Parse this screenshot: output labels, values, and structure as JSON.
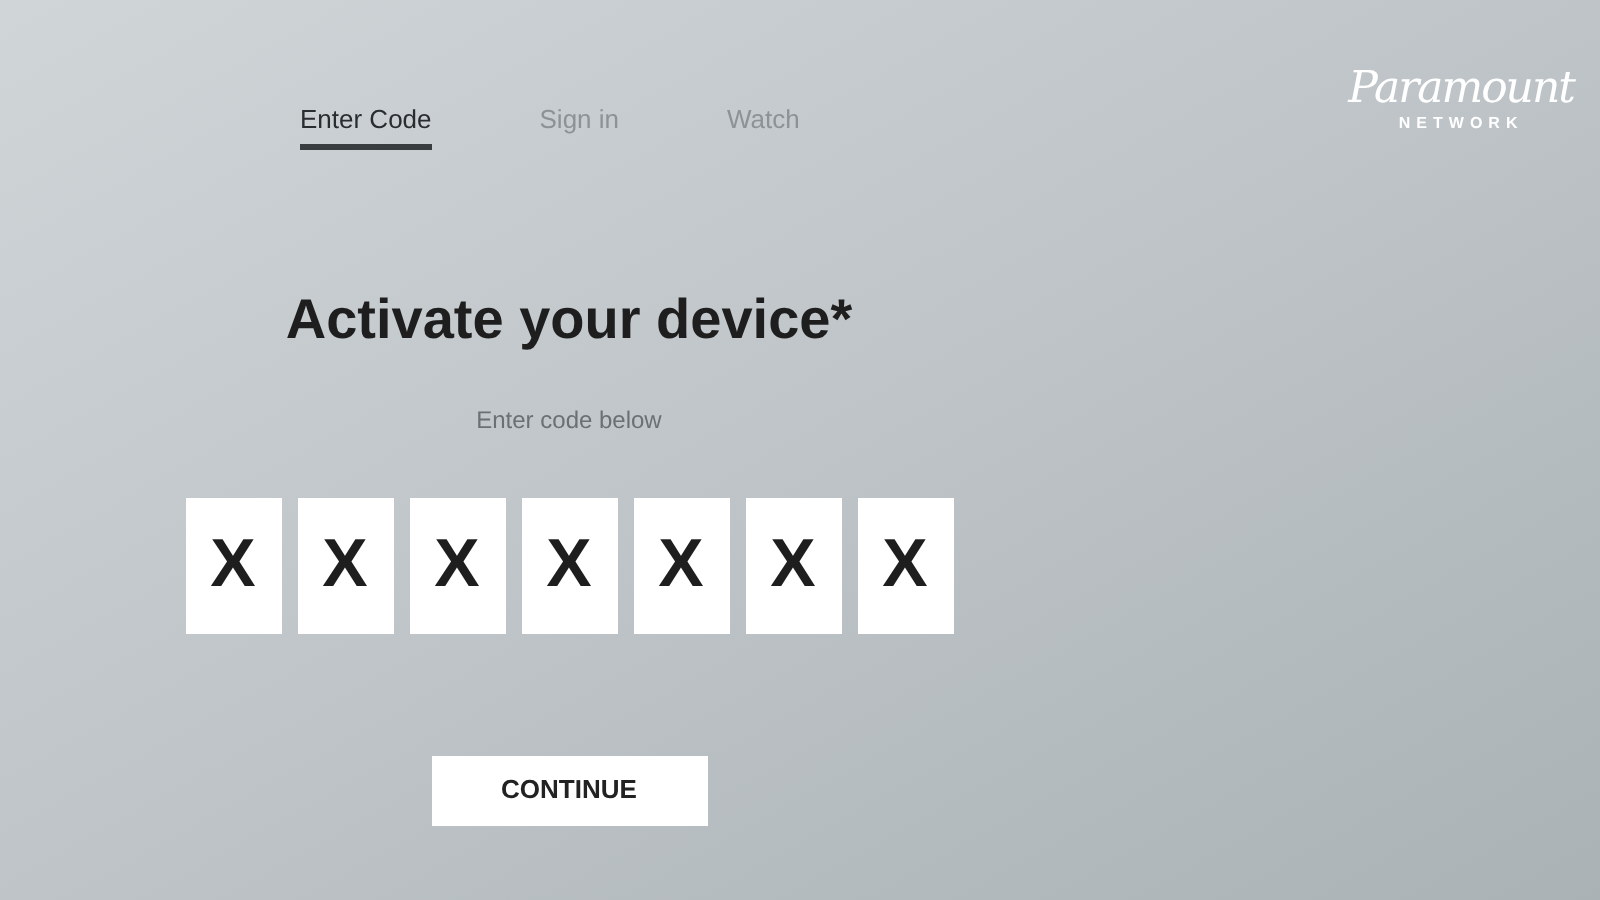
{
  "tabs": [
    {
      "label": "Enter Code",
      "selected": true
    },
    {
      "label": "Sign in",
      "selected": false
    },
    {
      "label": "Watch",
      "selected": false
    }
  ],
  "logo": {
    "name": "Paramount",
    "subtitle": "NETWORK"
  },
  "heading": "Activate your device*",
  "instruction": "Enter code below",
  "code": [
    "X",
    "X",
    "X",
    "X",
    "X",
    "X",
    "X"
  ],
  "button": "CONTINUE"
}
